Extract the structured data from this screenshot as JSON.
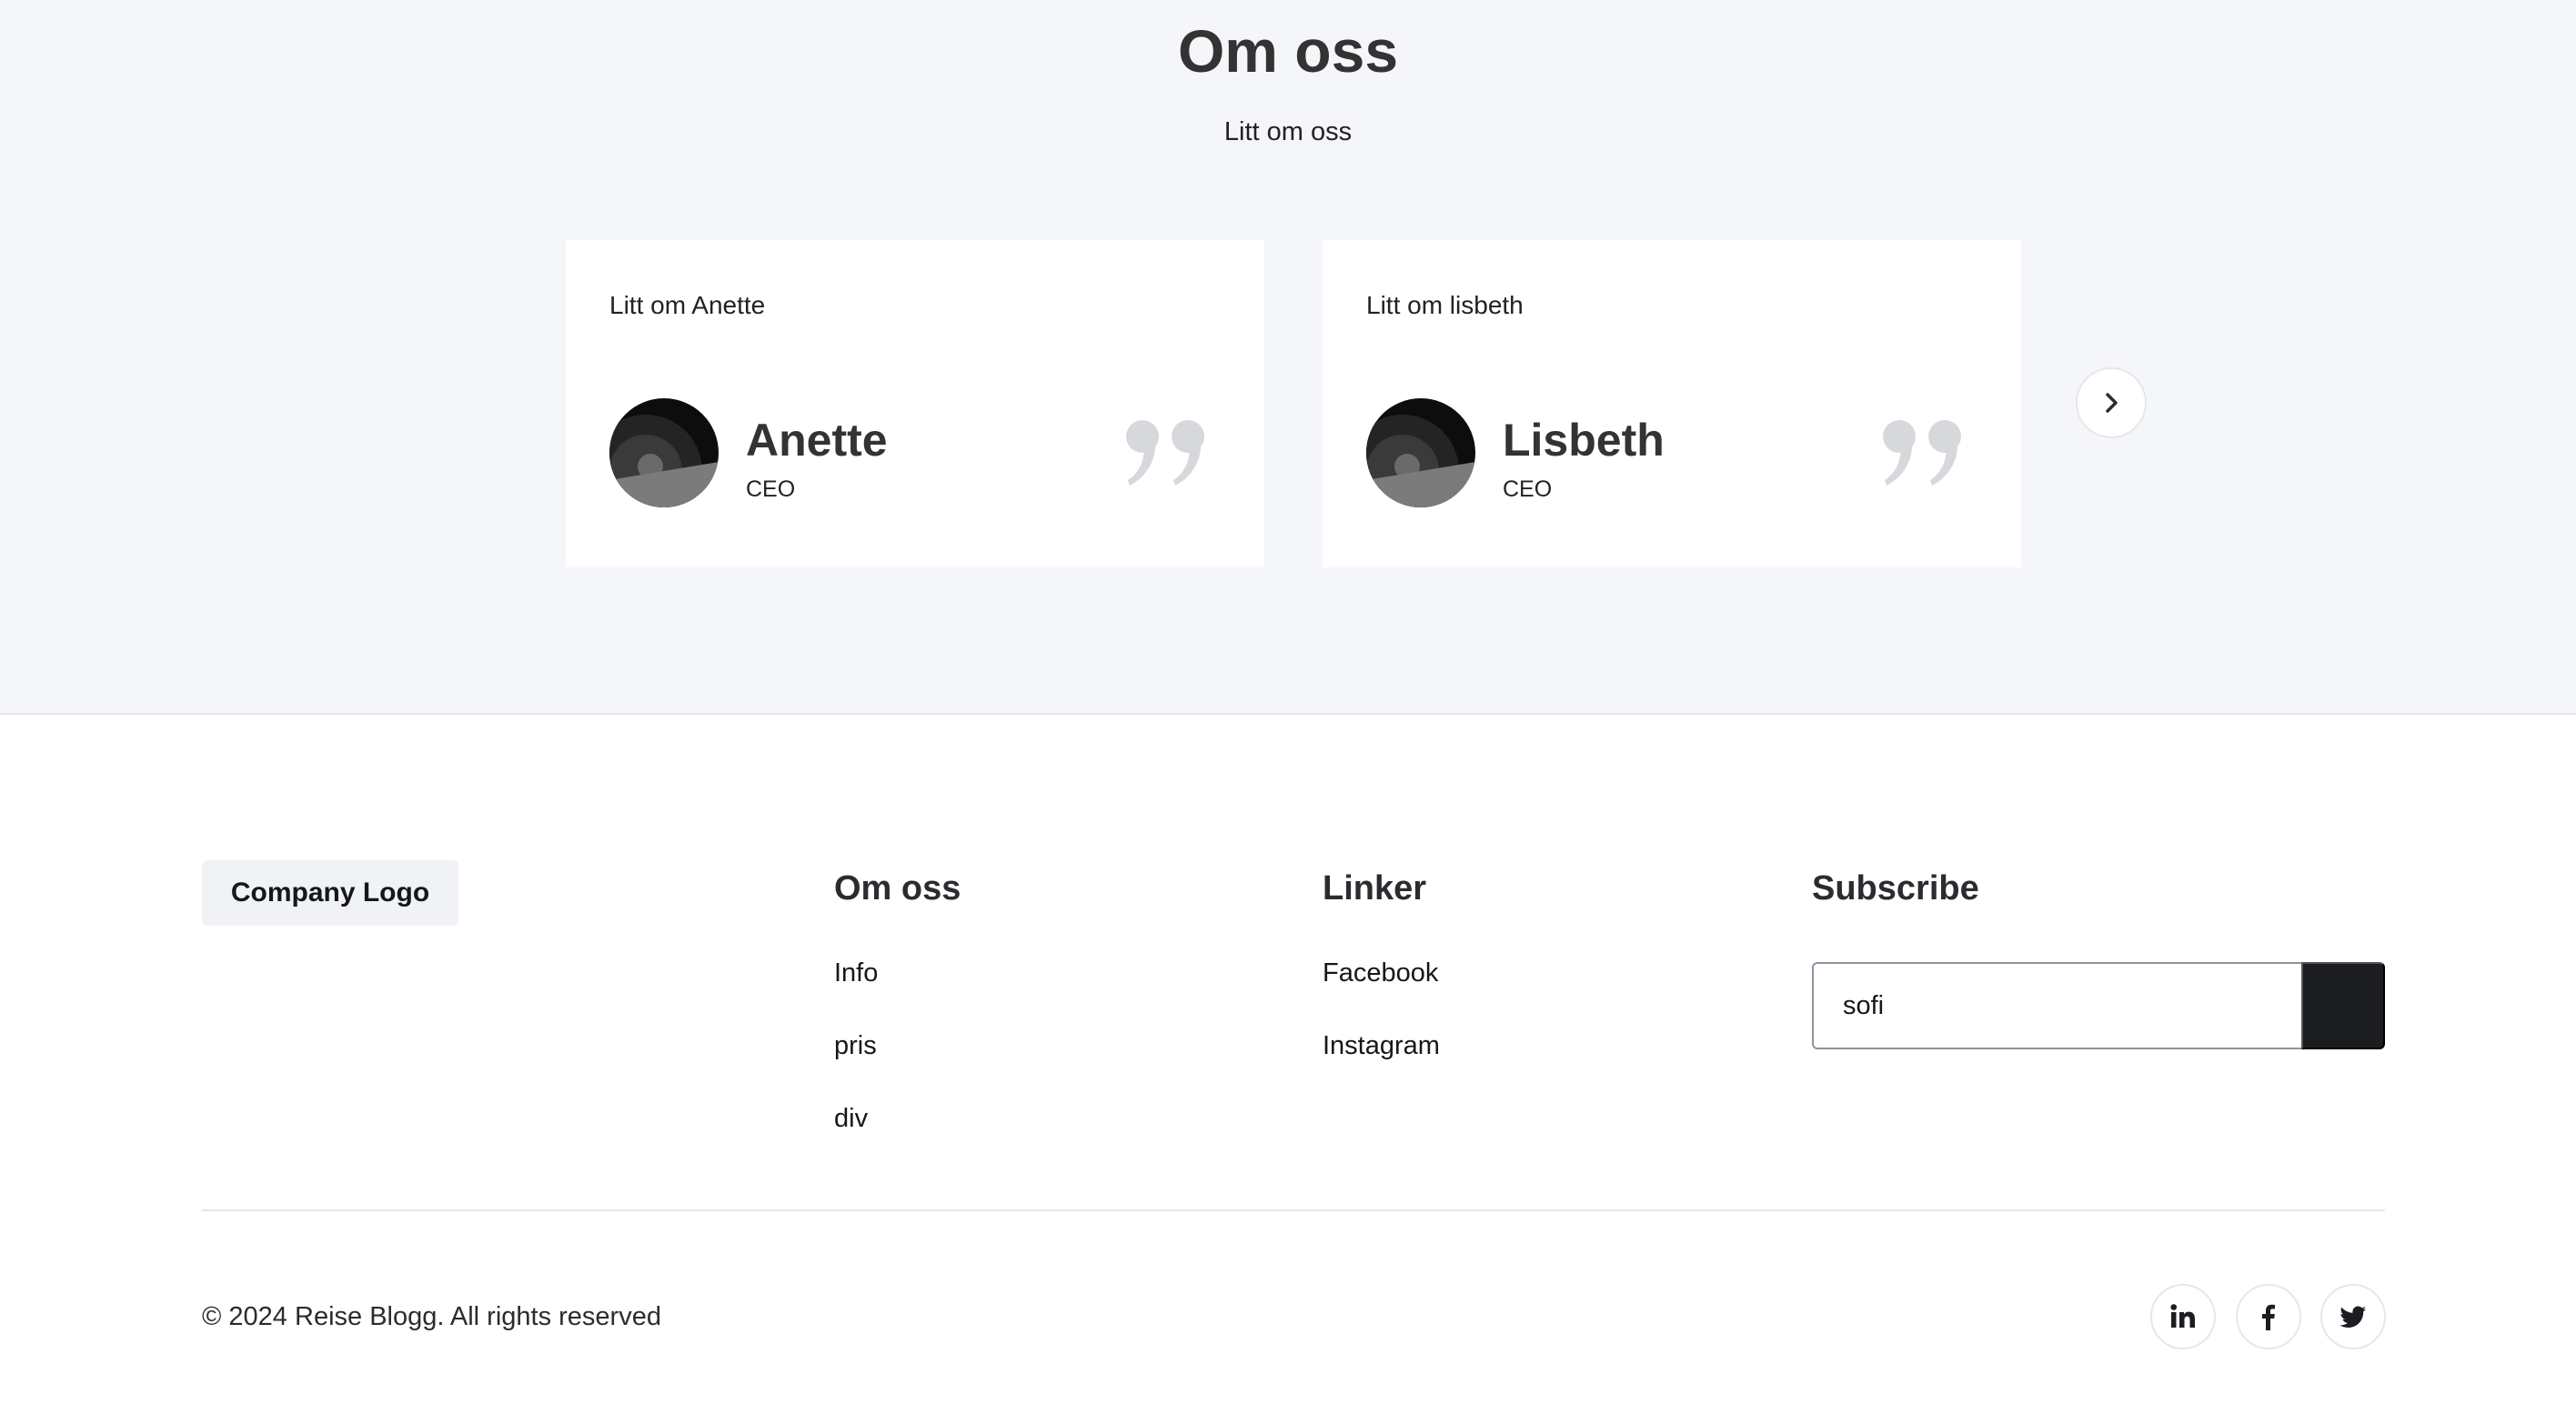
{
  "about": {
    "title": "Om oss",
    "subtitle": "Litt om oss",
    "cards": [
      {
        "text": "Litt om Anette",
        "name": "Anette",
        "role": "CEO"
      },
      {
        "text": "Litt om lisbeth",
        "name": "Lisbeth",
        "role": "CEO"
      }
    ],
    "next_icon": "chevron-right-icon"
  },
  "footer": {
    "logo": "Company Logo",
    "columns": [
      {
        "title": "Om oss",
        "links": [
          "Info",
          "pris",
          "div"
        ]
      },
      {
        "title": "Linker",
        "links": [
          "Facebook",
          "Instagram"
        ]
      }
    ],
    "subscribe": {
      "title": "Subscribe",
      "value": "sofi"
    },
    "copyright": "© 2024 Reise Blogg. All rights reserved",
    "social": [
      "linkedin-icon",
      "facebook-icon",
      "twitter-icon"
    ]
  },
  "colors": {
    "section_bg": "#f5f6fa",
    "button_dark": "#1c1d21",
    "quote_gray": "#d7d8dc"
  }
}
